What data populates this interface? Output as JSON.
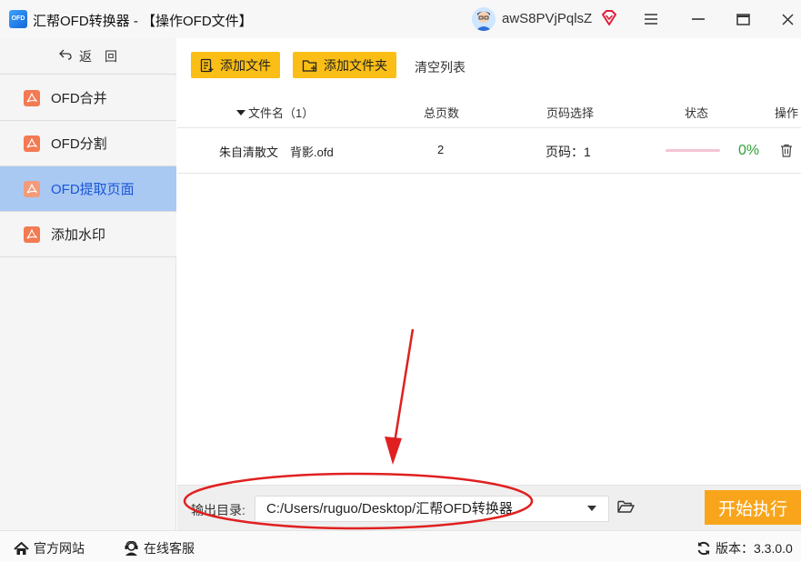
{
  "window": {
    "logo_text": "OFD",
    "title": "汇帮OFD转换器 - 【操作OFD文件】",
    "user_name": "awS8PVjPqlsZ"
  },
  "sidebar": {
    "back_label": "返　回",
    "items": [
      {
        "label": "OFD合并",
        "active": false
      },
      {
        "label": "OFD分割",
        "active": false
      },
      {
        "label": "OFD提取页面",
        "active": true
      },
      {
        "label": "添加水印",
        "active": false
      }
    ]
  },
  "toolbar": {
    "add_file": "添加文件",
    "add_folder": "添加文件夹",
    "clear_list": "清空列表"
  },
  "table": {
    "columns": {
      "filename": "文件名（1）",
      "pages": "总页数",
      "page_select": "页码选择",
      "status": "状态",
      "action": "操作"
    },
    "rows": [
      {
        "filename": "朱自清散文　背影.ofd",
        "pages": "2",
        "page_select": "页码：1",
        "progress": "0%",
        "progress_fraction": 0
      }
    ]
  },
  "output": {
    "label": "输出目录:",
    "path": "C:/Users/ruguo/Desktop/汇帮OFD转换器",
    "start_button": "开始执行"
  },
  "footer": {
    "website": "官方网站",
    "support": "在线客服",
    "version_label": "版本：",
    "version": "3.3.0.0"
  },
  "colors": {
    "accent_yellow": "#fbbe16",
    "start_orange": "#f9a51b",
    "active_item_bg": "#a9c9f3",
    "active_item_text": "#1b56d6",
    "progress_green": "#2fa336",
    "annotation_red": "#e02020"
  }
}
